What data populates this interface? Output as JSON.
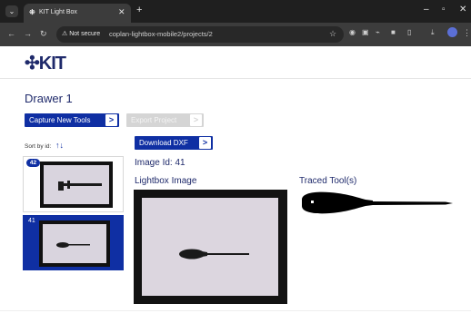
{
  "browser": {
    "tab_title": "KIT Light Box",
    "tab_favicon": "KIT",
    "not_secure": "Not secure",
    "url": "coplan-lightbox-mobile2/projects/2"
  },
  "header": {
    "logo_text": "KIT"
  },
  "page": {
    "title": "Drawer 1",
    "capture_label": "Capture New Tools",
    "export_label": "Export Project",
    "download_label": "Download DXF",
    "chevron": ">",
    "sort_label": "Sort by id:",
    "image_id": "Image Id: 41",
    "lightbox_label": "Lightbox Image",
    "traced_label": "Traced Tool(s)"
  },
  "sidebar": {
    "cards": [
      {
        "id": "42",
        "selected": false
      },
      {
        "id": "41",
        "selected": true
      }
    ]
  },
  "colors": {
    "brand": "#1f2a6b",
    "accent": "#0f2fa3",
    "disabled": "#d5d5d5"
  }
}
